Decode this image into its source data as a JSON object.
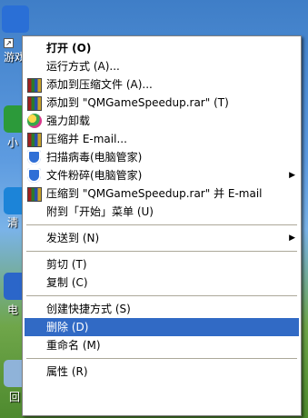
{
  "desktop": {
    "icons": [
      {
        "label": "游戏",
        "color": "#2a6fd6"
      },
      {
        "label": "小",
        "color": "#2c9a3a"
      },
      {
        "label": "清",
        "color": "#1c84d8"
      },
      {
        "label": "电",
        "color": "#2b66c9"
      },
      {
        "label": "回",
        "color": "#8fb3d9"
      }
    ]
  },
  "context_menu": {
    "items": [
      {
        "label": "打开 (O)",
        "icon": "none"
      },
      {
        "label": "运行方式 (A)...",
        "icon": "none"
      },
      {
        "label": "添加到压缩文件 (A)...",
        "icon": "winrar-icon"
      },
      {
        "label": "添加到 \"QMGameSpeedup.rar\" (T)",
        "icon": "winrar-icon"
      },
      {
        "label": "强力卸载",
        "icon": "uninstall-icon"
      },
      {
        "label": "压缩并 E-mail...",
        "icon": "winrar-icon"
      },
      {
        "label": "扫描病毒(电脑管家)",
        "icon": "shield-icon"
      },
      {
        "label": "文件粉碎(电脑管家)",
        "icon": "shield-icon"
      },
      {
        "label": "压缩到 \"QMGameSpeedup.rar\" 并 E-mail",
        "icon": "winrar-icon"
      },
      {
        "label": "附到「开始」菜单 (U)",
        "icon": "none"
      },
      {
        "label": "发送到 (N)",
        "icon": "none"
      },
      {
        "label": "剪切 (T)",
        "icon": "none"
      },
      {
        "label": "复制 (C)",
        "icon": "none"
      },
      {
        "label": "创建快捷方式 (S)",
        "icon": "none"
      },
      {
        "label": "删除 (D)",
        "icon": "none"
      },
      {
        "label": "重命名 (M)",
        "icon": "none"
      },
      {
        "label": "属性 (R)",
        "icon": "none"
      }
    ],
    "selected_item": "删除 (D)",
    "selection_color": "#316ac5"
  }
}
